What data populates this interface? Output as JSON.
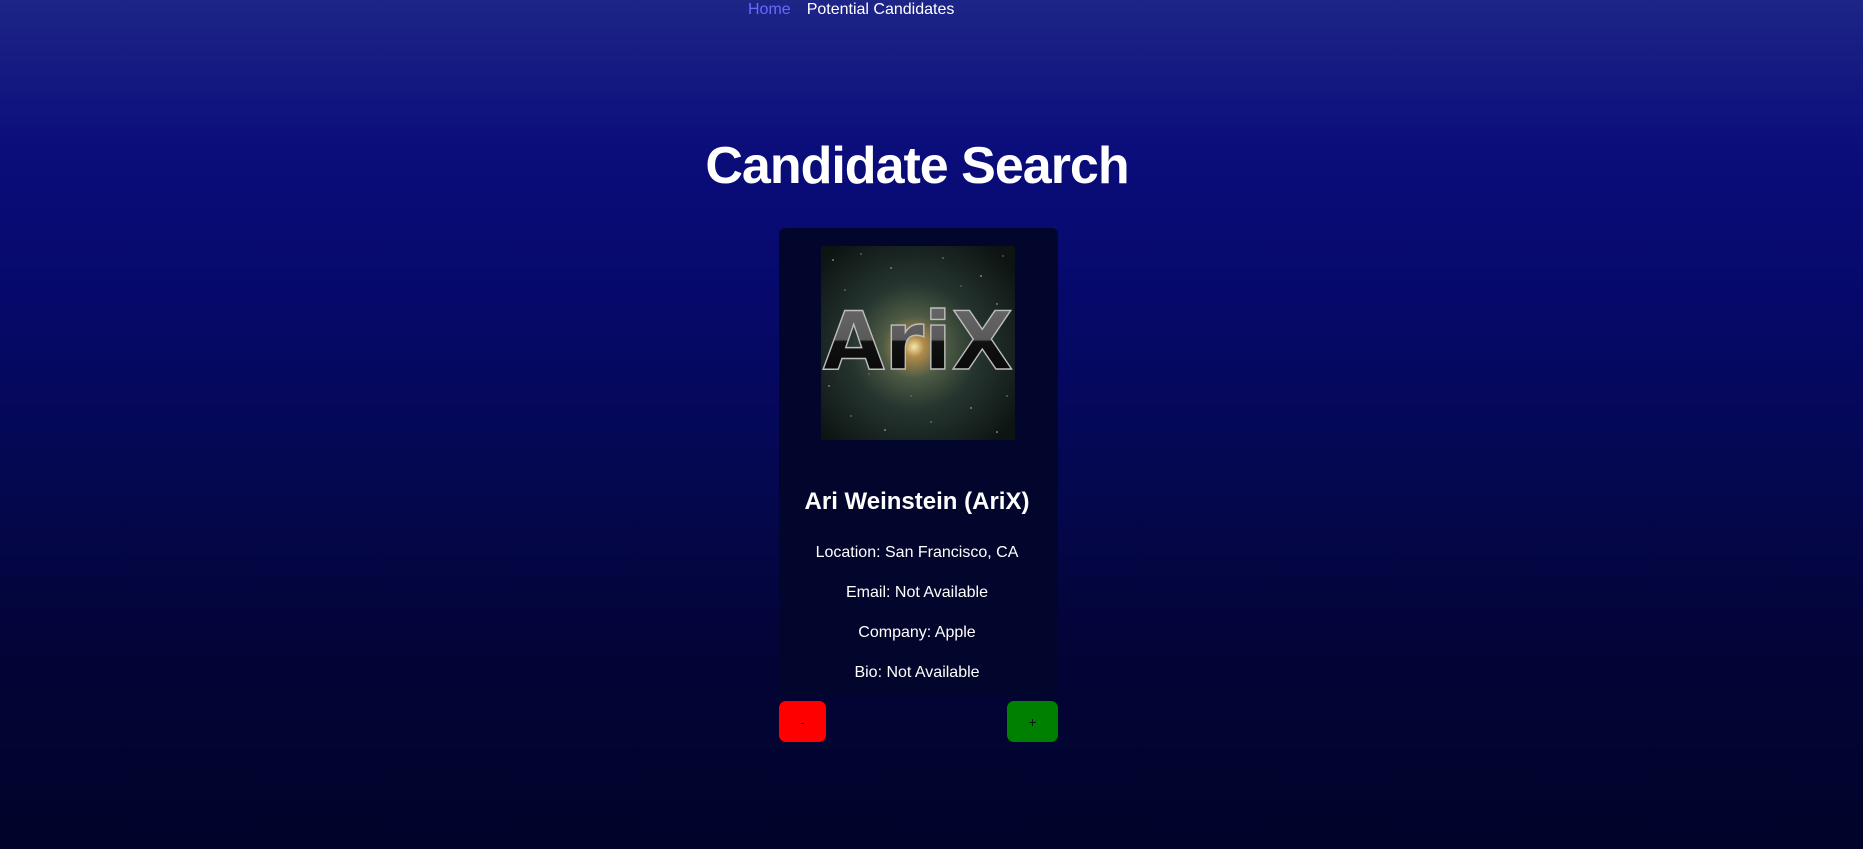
{
  "nav": {
    "home_label": "Home",
    "potential_label": "Potential Candidates"
  },
  "page": {
    "title": "Candidate Search"
  },
  "candidate": {
    "avatar_text": "AriX",
    "name": "Ari Weinstein (AriX)",
    "location": "Location: San Francisco, CA",
    "email": "Email: Not Available",
    "company": "Company: Apple",
    "bio": "Bio: Not Available"
  },
  "actions": {
    "reject_label": "-",
    "accept_label": "+"
  },
  "colors": {
    "link_active": "#646cff",
    "reject": "#ff0000",
    "accept": "#008000",
    "card_bg": "#03062c"
  }
}
